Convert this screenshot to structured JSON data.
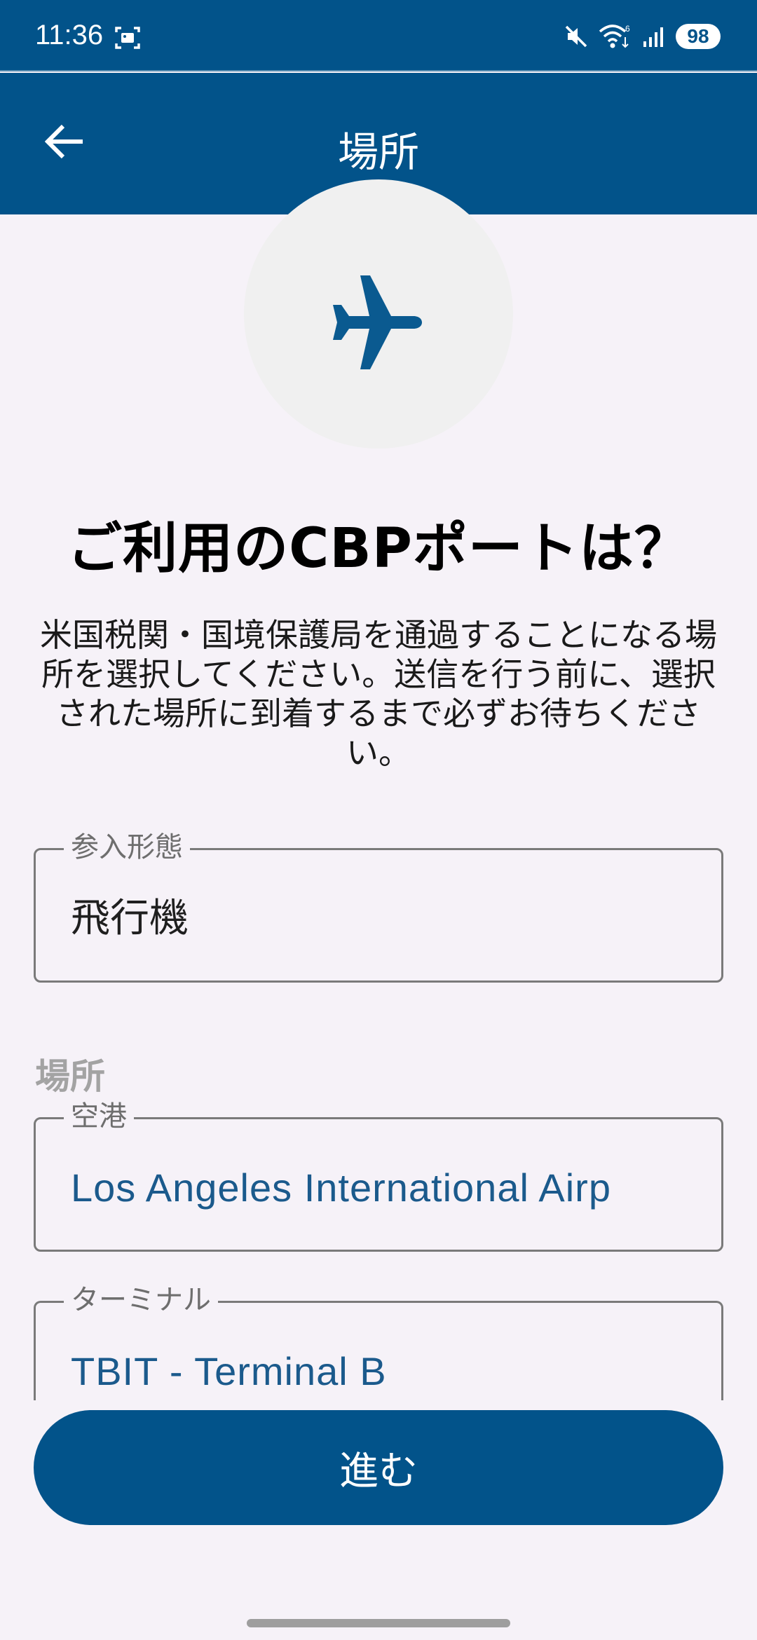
{
  "status_bar": {
    "time": "11:36",
    "battery": "98",
    "icons": [
      "screenshot-icon",
      "mute-icon",
      "wifi-icon",
      "signal-icon"
    ]
  },
  "app_bar": {
    "title": "場所",
    "back_icon": "arrow-left-icon"
  },
  "hero_icon": "airplane-icon",
  "heading": "ご利用のCBPポートは？",
  "description": "米国税関・国境保護局を通過することになる場所を選択してください。送信を行う前に、選択された場所に到着するまで必ずお待ちください。",
  "entry_type": {
    "label": "参入形態",
    "value": "飛行機"
  },
  "location_section": {
    "label": "場所",
    "airport": {
      "label": "空港",
      "value": "Los Angeles International Airp"
    },
    "terminal": {
      "label": "ターミナル",
      "value": "TBIT - Terminal B"
    }
  },
  "continue_button": {
    "label": "進む"
  },
  "colors": {
    "primary": "#02538a",
    "background": "#f6f2f8",
    "link_value": "#1b5a8c"
  }
}
